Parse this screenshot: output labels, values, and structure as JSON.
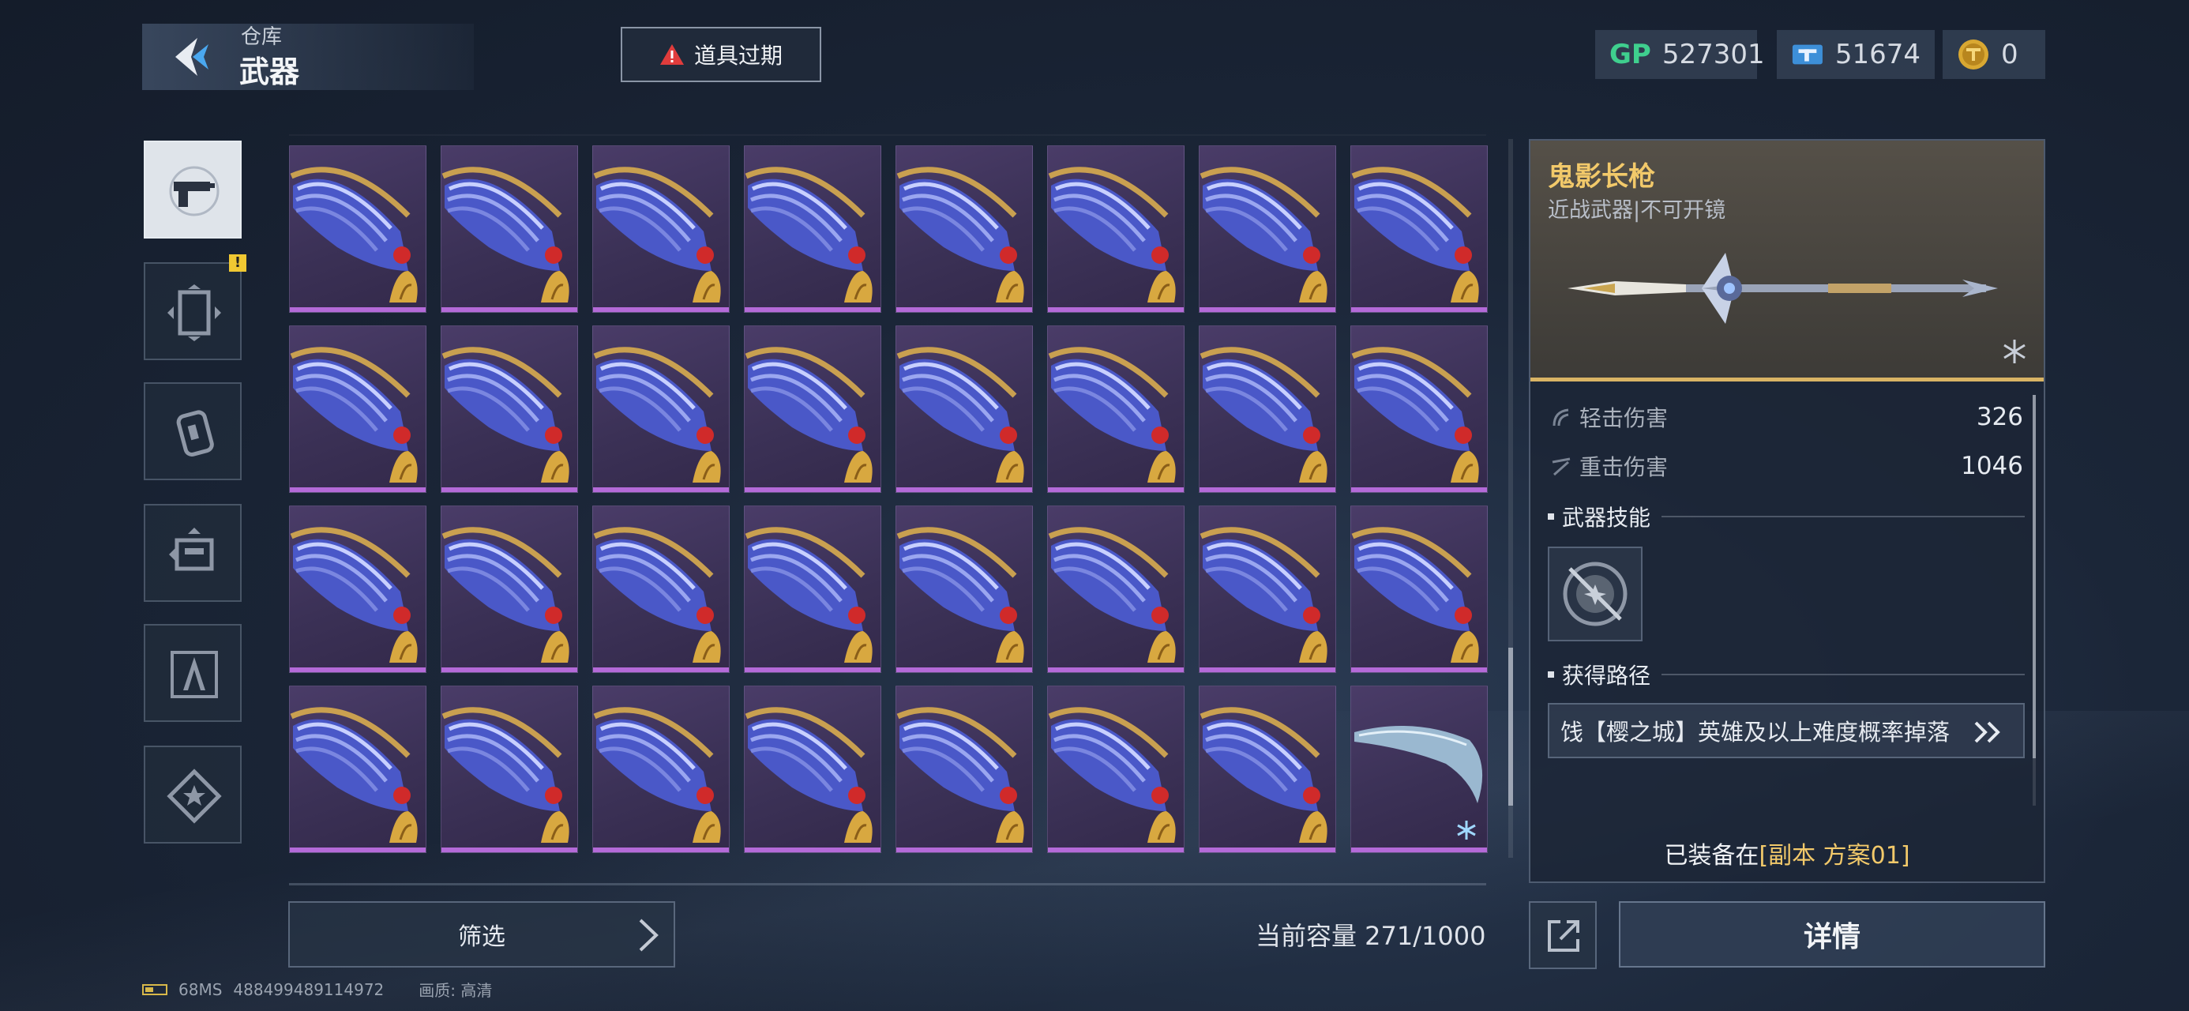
{
  "header": {
    "breadcrumb_parent": "仓库",
    "title": "武器",
    "alert_label": "道具过期"
  },
  "currencies": {
    "gp_label": "GP",
    "gp_value": "527301",
    "ticket_value": "51674",
    "coin_value": "0"
  },
  "side_tabs": [
    {
      "icon": "gun-icon",
      "active": true
    },
    {
      "icon": "armor-icon",
      "active": false,
      "badge": "!"
    },
    {
      "icon": "grenade-icon",
      "active": false
    },
    {
      "icon": "gadget-icon",
      "active": false
    },
    {
      "icon": "compass-icon",
      "active": false
    },
    {
      "icon": "star-badge-icon",
      "active": false
    }
  ],
  "grid": {
    "rows": 4,
    "cols": 8,
    "items": [
      "gauntlet",
      "gauntlet",
      "gauntlet",
      "gauntlet",
      "gauntlet",
      "gauntlet",
      "gauntlet",
      "gauntlet",
      "gauntlet",
      "gauntlet",
      "gauntlet",
      "gauntlet",
      "gauntlet",
      "gauntlet",
      "gauntlet",
      "gauntlet",
      "gauntlet",
      "gauntlet",
      "gauntlet",
      "gauntlet",
      "gauntlet",
      "gauntlet",
      "gauntlet",
      "gauntlet",
      "gauntlet",
      "gauntlet",
      "gauntlet",
      "gauntlet",
      "gauntlet",
      "gauntlet",
      "gauntlet",
      "blade"
    ],
    "rarity_color": "#b46ad8"
  },
  "footer": {
    "filter_label": "筛选",
    "capacity_text": "当前容量 271/1000"
  },
  "detail": {
    "name": "鬼影长枪",
    "subtitle": "近战武器|不可开镜",
    "stats": [
      {
        "label": "轻击伤害",
        "value": "326"
      },
      {
        "label": "重击伤害",
        "value": "1046"
      }
    ],
    "skill_section": "武器技能",
    "source_section": "获得路径",
    "source_text": "饯【樱之城】英雄及以上难度概率掉落",
    "equipped_prefix": "已装备在",
    "equipped_highlight": "[副本 方案01]",
    "detail_button": "详情",
    "accent_color": "#f2c96a"
  },
  "status": {
    "ping": "68MS",
    "id": "488499489114972",
    "quality": "画质: 高清"
  }
}
